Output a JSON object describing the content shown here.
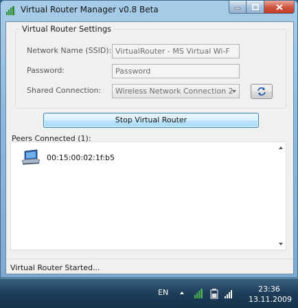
{
  "window": {
    "title": "Virtual Router Manager v0.8 Beta"
  },
  "settings": {
    "group_title": "Virtual Router Settings",
    "ssid_label": "Network Name (SSID):",
    "ssid_value": "VirtualRouter - MS Virtual Wi-F",
    "password_label": "Password:",
    "password_value": "Password",
    "shared_label": "Shared Connection:",
    "shared_value": "Wireless Network Connection 2"
  },
  "actions": {
    "stop_label": "Stop Virtual Router"
  },
  "peers": {
    "label": "Peers Connected (1):",
    "items": [
      {
        "mac": "00:15:00:02:1f:b5",
        "icon": "laptop-wifi-icon"
      }
    ]
  },
  "status": {
    "text": "Virtual Router Started..."
  },
  "taskbar": {
    "language": "EN",
    "time": "23:36",
    "date": "13.11.2009"
  },
  "colors": {
    "accent": "#3c7fb1",
    "close": "#c0381f"
  }
}
